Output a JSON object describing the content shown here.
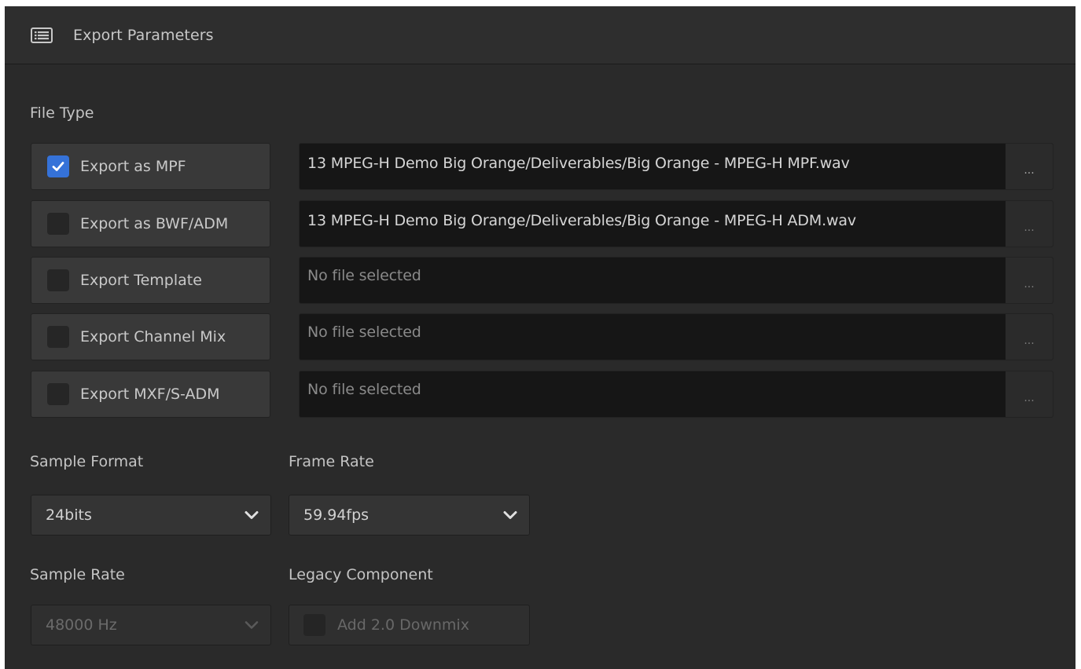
{
  "header": {
    "title": "Export Parameters",
    "icon": "list-icon"
  },
  "file_type": {
    "label": "File Type",
    "rows": [
      {
        "label": "Export as MPF",
        "checked": true,
        "path": "13 MPEG-H Demo Big Orange/Deliverables/Big Orange - MPEG-H MPF.wav",
        "browse": "..."
      },
      {
        "label": "Export as BWF/ADM",
        "checked": false,
        "path": "13 MPEG-H Demo Big Orange/Deliverables/Big Orange - MPEG-H ADM.wav",
        "browse": "..."
      },
      {
        "label": "Export Template",
        "checked": false,
        "path": "No file selected",
        "browse": "..."
      },
      {
        "label": "Export Channel Mix",
        "checked": false,
        "path": "No file selected",
        "browse": "..."
      },
      {
        "label": "Export MXF/S-ADM",
        "checked": false,
        "path": "No file selected",
        "browse": "..."
      }
    ]
  },
  "sample_format": {
    "label": "Sample Format",
    "value": "24bits"
  },
  "frame_rate": {
    "label": "Frame Rate",
    "value": "59.94fps"
  },
  "sample_rate": {
    "label": "Sample Rate",
    "value": "48000 Hz",
    "disabled": true
  },
  "legacy_component": {
    "label": "Legacy Component",
    "option_label": "Add 2.0 Downmix",
    "checked": false,
    "disabled": true
  },
  "colors": {
    "background": "#2a2a2a",
    "accent": "#3572d8",
    "field": "#161616"
  }
}
